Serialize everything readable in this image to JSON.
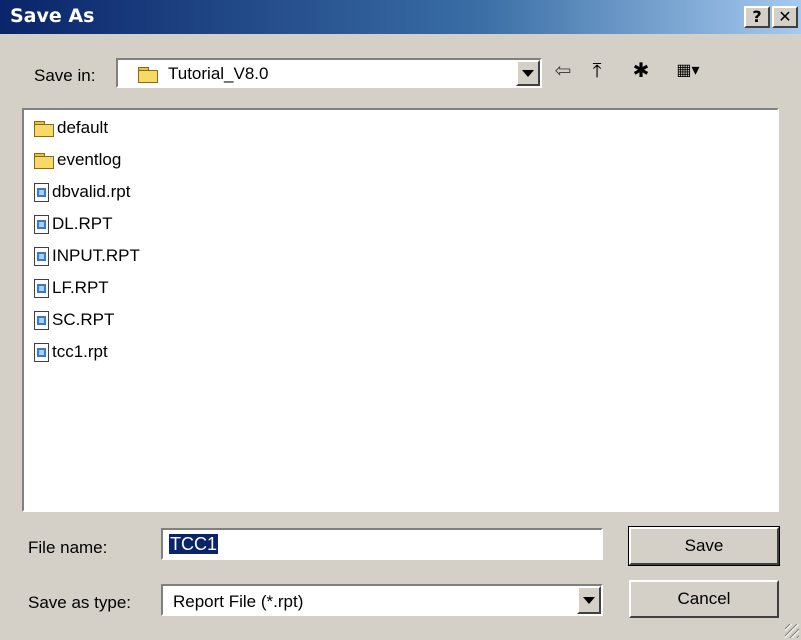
{
  "window": {
    "title": "Save As",
    "help_label": "?",
    "close_label": "✕"
  },
  "save_in": {
    "label": "Save in:",
    "value": "Tutorial_V8.0",
    "folder_icon": "folder-icon",
    "tools": [
      {
        "name": "back-icon",
        "glyph": "⇦"
      },
      {
        "name": "up-one-level-icon",
        "glyph": "⤒"
      },
      {
        "name": "new-folder-icon",
        "glyph": "✱"
      },
      {
        "name": "view-menu-icon",
        "glyph": "▦▾"
      }
    ]
  },
  "files": [
    {
      "name": "default",
      "kind": "folder"
    },
    {
      "name": "eventlog",
      "kind": "folder"
    },
    {
      "name": "dbvalid.rpt",
      "kind": "file"
    },
    {
      "name": "DL.RPT",
      "kind": "file"
    },
    {
      "name": "INPUT.RPT",
      "kind": "file"
    },
    {
      "name": "LF.RPT",
      "kind": "file"
    },
    {
      "name": "SC.RPT",
      "kind": "file"
    },
    {
      "name": "tcc1.rpt",
      "kind": "file"
    }
  ],
  "file_name": {
    "label": "File name:",
    "value": "TCC1"
  },
  "save_as_type": {
    "label": "Save as type:",
    "value": "Report File (*.rpt)"
  },
  "buttons": {
    "save": "Save",
    "cancel": "Cancel"
  }
}
